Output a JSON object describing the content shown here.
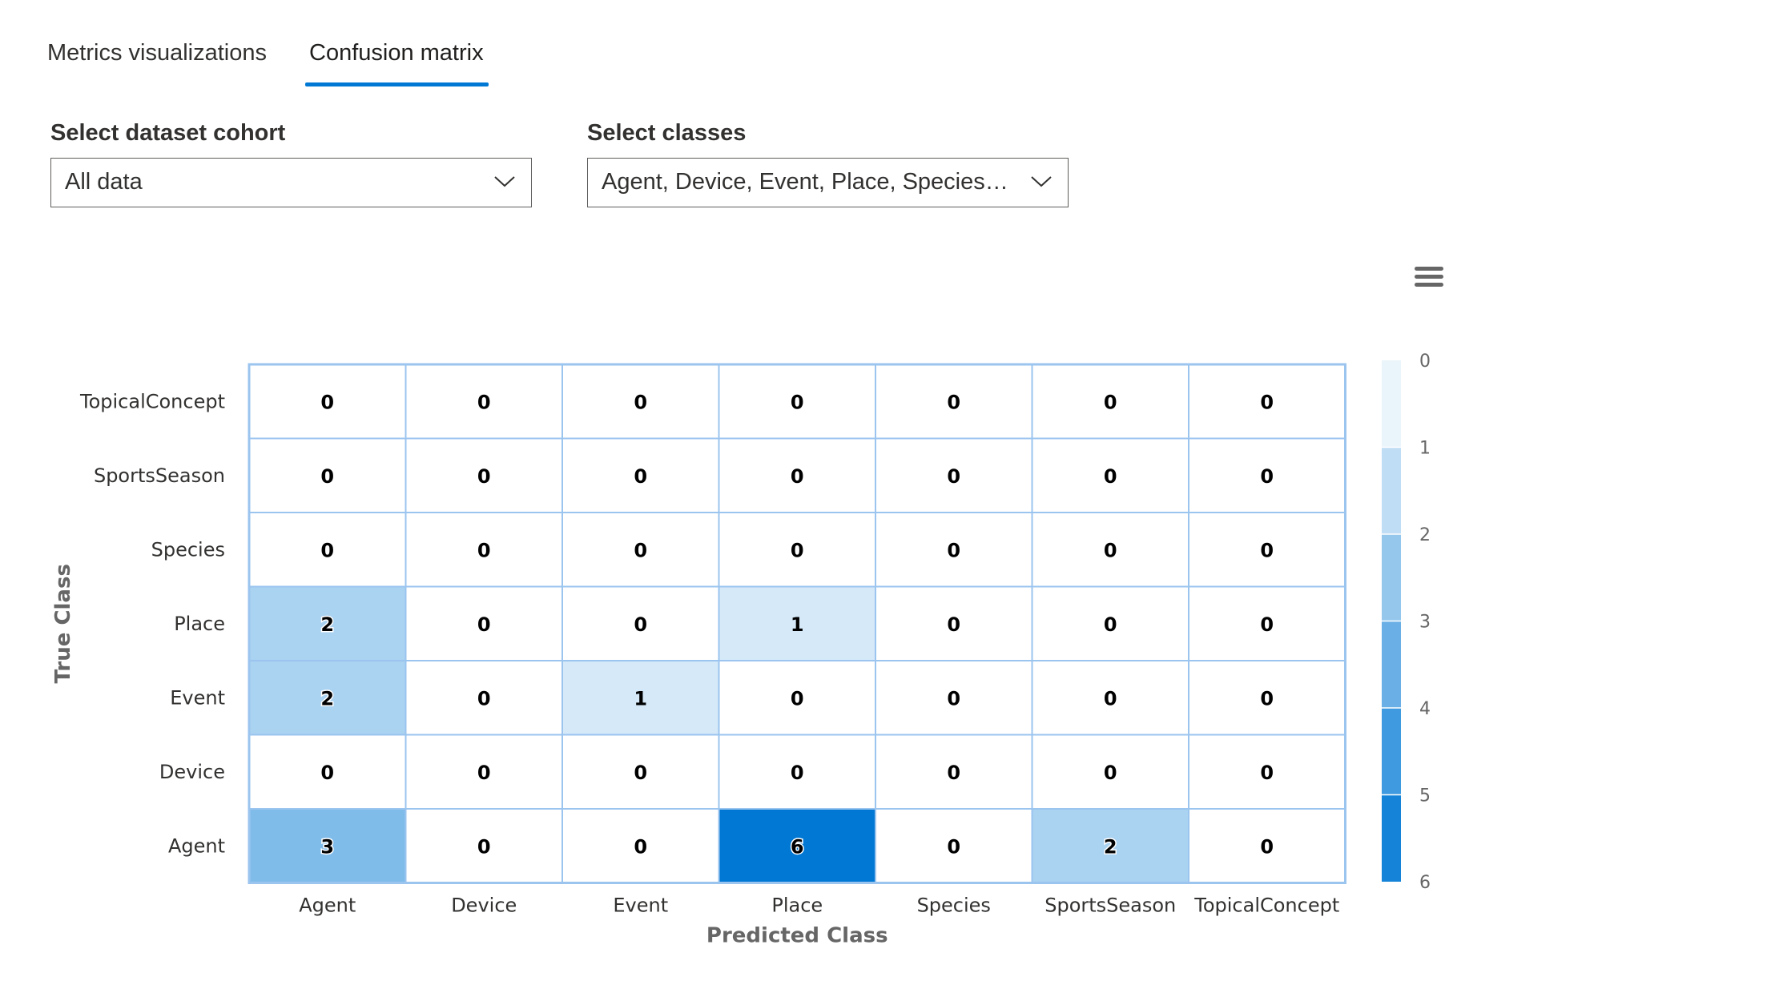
{
  "tabs": [
    {
      "label": "Metrics visualizations",
      "selected": false
    },
    {
      "label": "Confusion matrix",
      "selected": true
    }
  ],
  "cohort": {
    "label": "Select dataset cohort",
    "value": "All data"
  },
  "classes": {
    "label": "Select classes",
    "value": "Agent, Device, Event, Place, Species, SportsSeason, TopicalConcept"
  },
  "icons": {
    "dropdown": "chevron-down-icon",
    "chart_menu": "hamburger-menu-icon"
  },
  "colors": {
    "accent": "#0078d4",
    "grid": "#9bc4ef",
    "min": "#ffffff",
    "max": "#0078d4",
    "text": "#323130"
  },
  "chart_data": {
    "type": "heatmap",
    "xlabel": "Predicted Class",
    "ylabel": "True Class",
    "x_categories": [
      "Agent",
      "Device",
      "Event",
      "Place",
      "Species",
      "SportsSeason",
      "TopicalConcept"
    ],
    "y_categories": [
      "TopicalConcept",
      "SportsSeason",
      "Species",
      "Place",
      "Event",
      "Device",
      "Agent"
    ],
    "values": [
      [
        0,
        0,
        0,
        0,
        0,
        0,
        0
      ],
      [
        0,
        0,
        0,
        0,
        0,
        0,
        0
      ],
      [
        0,
        0,
        0,
        0,
        0,
        0,
        0
      ],
      [
        2,
        0,
        0,
        1,
        0,
        0,
        0
      ],
      [
        2,
        0,
        1,
        0,
        0,
        0,
        0
      ],
      [
        0,
        0,
        0,
        0,
        0,
        0,
        0
      ],
      [
        3,
        0,
        0,
        6,
        0,
        2,
        0
      ]
    ],
    "color_range": [
      0,
      6
    ],
    "colorbar_ticks": [
      "0",
      "1",
      "2",
      "3",
      "4",
      "5",
      "6"
    ]
  }
}
